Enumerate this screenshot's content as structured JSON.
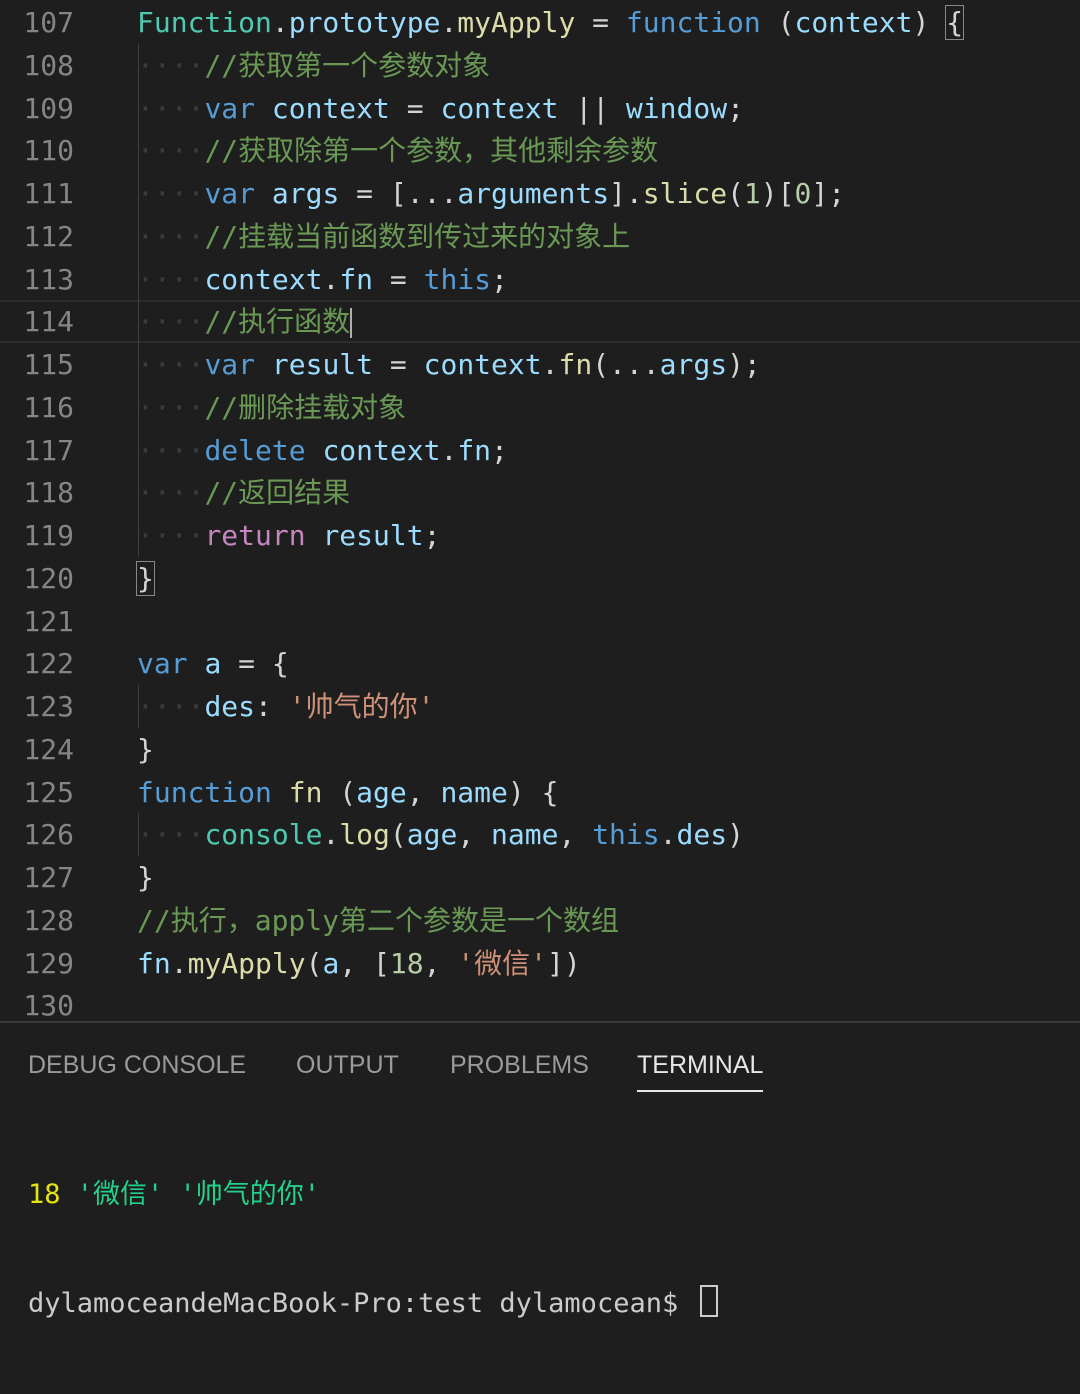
{
  "editor": {
    "lines": [
      {
        "number": "107",
        "guides": 0,
        "tokens": [
          {
            "t": "Function",
            "c": "cls"
          },
          {
            "t": ".",
            "c": "p"
          },
          {
            "t": "prototype",
            "c": "prop"
          },
          {
            "t": ".",
            "c": "p"
          },
          {
            "t": "myApply",
            "c": "fn"
          },
          {
            "t": " = ",
            "c": "p"
          },
          {
            "t": "function",
            "c": "kw"
          },
          {
            "t": " (",
            "c": "p"
          },
          {
            "t": "context",
            "c": "var"
          },
          {
            "t": ") ",
            "c": "p"
          },
          {
            "t": "{",
            "c": "bracket"
          }
        ]
      },
      {
        "number": "108",
        "guides": 1,
        "tokens": [
          {
            "t": "//获取第一个参数对象",
            "c": "cm"
          }
        ]
      },
      {
        "number": "109",
        "guides": 1,
        "tokens": [
          {
            "t": "var",
            "c": "kw"
          },
          {
            "t": " ",
            "c": "p"
          },
          {
            "t": "context",
            "c": "var"
          },
          {
            "t": " = ",
            "c": "p"
          },
          {
            "t": "context",
            "c": "var"
          },
          {
            "t": " || ",
            "c": "p"
          },
          {
            "t": "window",
            "c": "var"
          },
          {
            "t": ";",
            "c": "p"
          }
        ]
      },
      {
        "number": "110",
        "guides": 1,
        "tokens": [
          {
            "t": "//获取除第一个参数，其他剩余参数",
            "c": "cm"
          }
        ]
      },
      {
        "number": "111",
        "guides": 1,
        "tokens": [
          {
            "t": "var",
            "c": "kw"
          },
          {
            "t": " ",
            "c": "p"
          },
          {
            "t": "args",
            "c": "var"
          },
          {
            "t": " = [...",
            "c": "p"
          },
          {
            "t": "arguments",
            "c": "var"
          },
          {
            "t": "].",
            "c": "p"
          },
          {
            "t": "slice",
            "c": "fn"
          },
          {
            "t": "(",
            "c": "p"
          },
          {
            "t": "1",
            "c": "num"
          },
          {
            "t": ")[",
            "c": "p"
          },
          {
            "t": "0",
            "c": "num"
          },
          {
            "t": "];",
            "c": "p"
          }
        ]
      },
      {
        "number": "112",
        "guides": 1,
        "tokens": [
          {
            "t": "//挂载当前函数到传过来的对象上",
            "c": "cm"
          }
        ]
      },
      {
        "number": "113",
        "guides": 1,
        "tokens": [
          {
            "t": "context",
            "c": "var"
          },
          {
            "t": ".",
            "c": "p"
          },
          {
            "t": "fn",
            "c": "var"
          },
          {
            "t": " = ",
            "c": "p"
          },
          {
            "t": "this",
            "c": "kw"
          },
          {
            "t": ";",
            "c": "p"
          }
        ]
      },
      {
        "number": "114",
        "guides": 1,
        "current": true,
        "cursor": true,
        "tokens": [
          {
            "t": "//执行函数",
            "c": "cm"
          }
        ]
      },
      {
        "number": "115",
        "guides": 1,
        "tokens": [
          {
            "t": "var",
            "c": "kw"
          },
          {
            "t": " ",
            "c": "p"
          },
          {
            "t": "result",
            "c": "var"
          },
          {
            "t": " = ",
            "c": "p"
          },
          {
            "t": "context",
            "c": "var"
          },
          {
            "t": ".",
            "c": "p"
          },
          {
            "t": "fn",
            "c": "fn"
          },
          {
            "t": "(...",
            "c": "p"
          },
          {
            "t": "args",
            "c": "var"
          },
          {
            "t": ");",
            "c": "p"
          }
        ]
      },
      {
        "number": "116",
        "guides": 1,
        "tokens": [
          {
            "t": "//删除挂载对象",
            "c": "cm"
          }
        ]
      },
      {
        "number": "117",
        "guides": 1,
        "tokens": [
          {
            "t": "delete",
            "c": "kw"
          },
          {
            "t": " ",
            "c": "p"
          },
          {
            "t": "context",
            "c": "var"
          },
          {
            "t": ".",
            "c": "p"
          },
          {
            "t": "fn",
            "c": "var"
          },
          {
            "t": ";",
            "c": "p"
          }
        ]
      },
      {
        "number": "118",
        "guides": 1,
        "tokens": [
          {
            "t": "//返回结果",
            "c": "cm"
          }
        ]
      },
      {
        "number": "119",
        "guides": 1,
        "tokens": [
          {
            "t": "return",
            "c": "ctrl"
          },
          {
            "t": " ",
            "c": "p"
          },
          {
            "t": "result",
            "c": "var"
          },
          {
            "t": ";",
            "c": "p"
          }
        ]
      },
      {
        "number": "120",
        "guides": 0,
        "tokens": [
          {
            "t": "}",
            "c": "bracket"
          }
        ]
      },
      {
        "number": "121",
        "guides": 0,
        "tokens": []
      },
      {
        "number": "122",
        "guides": 0,
        "tokens": [
          {
            "t": "var",
            "c": "kw"
          },
          {
            "t": " ",
            "c": "p"
          },
          {
            "t": "a",
            "c": "var"
          },
          {
            "t": " = {",
            "c": "p"
          }
        ]
      },
      {
        "number": "123",
        "guides": 1,
        "tokens": [
          {
            "t": "des",
            "c": "var"
          },
          {
            "t": ": ",
            "c": "p"
          },
          {
            "t": "'帅气的你'",
            "c": "str"
          }
        ]
      },
      {
        "number": "124",
        "guides": 0,
        "tokens": [
          {
            "t": "}",
            "c": "p"
          }
        ]
      },
      {
        "number": "125",
        "guides": 0,
        "tokens": [
          {
            "t": "function",
            "c": "kw"
          },
          {
            "t": " ",
            "c": "p"
          },
          {
            "t": "fn",
            "c": "fn"
          },
          {
            "t": " (",
            "c": "p"
          },
          {
            "t": "age",
            "c": "var"
          },
          {
            "t": ", ",
            "c": "p"
          },
          {
            "t": "name",
            "c": "var"
          },
          {
            "t": ") {",
            "c": "p"
          }
        ]
      },
      {
        "number": "126",
        "guides": 1,
        "tokens": [
          {
            "t": "console",
            "c": "cls"
          },
          {
            "t": ".",
            "c": "p"
          },
          {
            "t": "log",
            "c": "fn"
          },
          {
            "t": "(",
            "c": "p"
          },
          {
            "t": "age",
            "c": "var"
          },
          {
            "t": ", ",
            "c": "p"
          },
          {
            "t": "name",
            "c": "var"
          },
          {
            "t": ", ",
            "c": "p"
          },
          {
            "t": "this",
            "c": "kw"
          },
          {
            "t": ".",
            "c": "p"
          },
          {
            "t": "des",
            "c": "var"
          },
          {
            "t": ")",
            "c": "p"
          }
        ]
      },
      {
        "number": "127",
        "guides": 0,
        "tokens": [
          {
            "t": "}",
            "c": "p"
          }
        ]
      },
      {
        "number": "128",
        "guides": 0,
        "tokens": [
          {
            "t": "//执行，apply第二个参数是一个数组",
            "c": "cm"
          }
        ]
      },
      {
        "number": "129",
        "guides": 0,
        "tokens": [
          {
            "t": "fn",
            "c": "var"
          },
          {
            "t": ".",
            "c": "p"
          },
          {
            "t": "myApply",
            "c": "fn"
          },
          {
            "t": "(",
            "c": "p"
          },
          {
            "t": "a",
            "c": "var"
          },
          {
            "t": ", [",
            "c": "p"
          },
          {
            "t": "18",
            "c": "num"
          },
          {
            "t": ", ",
            "c": "p"
          },
          {
            "t": "'微信'",
            "c": "str"
          },
          {
            "t": "])",
            "c": "p"
          }
        ]
      },
      {
        "number": "130",
        "guides": 0,
        "tokens": []
      }
    ]
  },
  "panel": {
    "tabs": [
      {
        "label": "DEBUG CONSOLE",
        "active": false
      },
      {
        "label": "OUTPUT",
        "active": false
      },
      {
        "label": "PROBLEMS",
        "active": false
      },
      {
        "label": "TERMINAL",
        "active": true
      }
    ],
    "terminal": {
      "output_number": "18",
      "output_strings": " '微信' '帅气的你'",
      "prompt": "dylamoceandeMacBook-Pro:test dylamocean$ "
    }
  },
  "colors": {
    "background": "#1e1e1e",
    "keyword": "#569cd6",
    "control": "#c586c0",
    "function": "#dcdcaa",
    "variable": "#9cdcfe",
    "class": "#4ec9b0",
    "comment": "#6a9955",
    "string": "#ce9178",
    "number": "#b5cea8",
    "terminal_number": "#e5e510",
    "terminal_string": "#23d18b"
  }
}
